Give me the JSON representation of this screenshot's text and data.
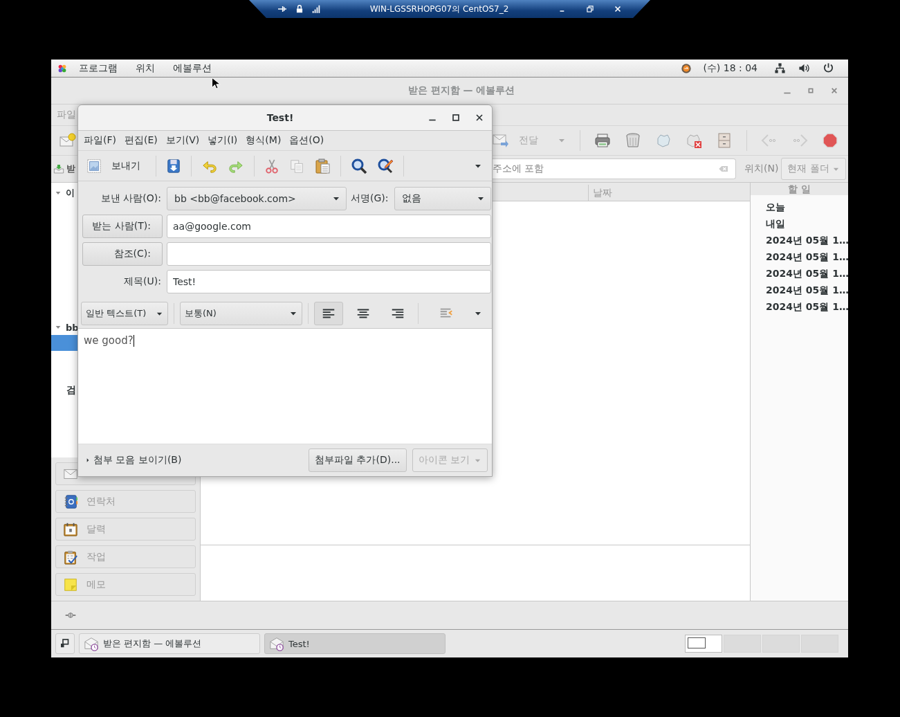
{
  "remote_bar": {
    "title": "WIN-LGSSRHOPG07의 CentOS7_2"
  },
  "top_panel": {
    "menus": [
      "프로그램",
      "위치",
      "에볼루션"
    ],
    "clock": "(수) 18 : 04"
  },
  "main_window": {
    "title": "받은 편지함 — 에볼루션",
    "menu": [
      "파일"
    ],
    "toolbar": {
      "forward": {
        "label": "전달",
        "disabled": true
      }
    },
    "search": {
      "account": "받",
      "placeholder": "주소에 포함",
      "scope_label": "위치(N)",
      "scope_value": "현재 폴더"
    },
    "folders": [
      {
        "label": "이",
        "expanded": true
      },
      {
        "label": "bb",
        "expanded": true,
        "children": [
          {
            "selected": true
          }
        ]
      }
    ],
    "search_folders": "검",
    "switcher": [
      {
        "kind": "mail"
      },
      {
        "kind": "contacts",
        "label": "연락처"
      },
      {
        "kind": "calendar",
        "label": "달력"
      },
      {
        "kind": "tasks",
        "label": "작업"
      },
      {
        "kind": "memos",
        "label": "메모"
      }
    ],
    "message_list": {
      "columns": [
        "날짜"
      ]
    },
    "todo": {
      "title": "할 일",
      "items": [
        "오늘",
        "내일",
        "2024년 05월 1…",
        "2024년 05월 1…",
        "2024년 05월 1…",
        "2024년 05월 1…",
        "2024년 05월 1…"
      ]
    }
  },
  "compose": {
    "title": "Test!",
    "menu": [
      "파일(F)",
      "편집(E)",
      "보기(V)",
      "넣기(I)",
      "형식(M)",
      "옵션(O)"
    ],
    "send_label": "보내기",
    "from": {
      "label": "보낸 사람(O):",
      "value": "bb <bb@facebook.com>"
    },
    "signature": {
      "label": "서명(G):",
      "value": "없음"
    },
    "to": {
      "label": "받는 사람(T):",
      "value": "aa@google.com"
    },
    "cc": {
      "label": "참조(C):"
    },
    "subject": {
      "label": "제목(U):",
      "value": "Test!"
    },
    "format": {
      "mode": "일반 텍스트(T)",
      "paragraph": "보통(N)",
      "alignments": [
        {
          "kind": "left",
          "selected": true
        },
        {
          "kind": "center",
          "selected": false
        },
        {
          "kind": "right",
          "selected": false
        }
      ]
    },
    "body": "we good?",
    "attachment_toggle": "첨부 모음 보이기(B)",
    "add_attachment": "첨부파일 추가(D)...",
    "view_mode": {
      "label": "아이콘 보기",
      "disabled": true
    }
  },
  "taskbar": {
    "tasks": [
      {
        "label": "받은 편지함 — 에볼루션",
        "selected": false
      },
      {
        "label": "Test!",
        "selected": true
      }
    ],
    "workspaces": [
      {
        "selected": true
      },
      {
        "selected": false
      },
      {
        "selected": false
      },
      {
        "selected": false
      }
    ]
  }
}
